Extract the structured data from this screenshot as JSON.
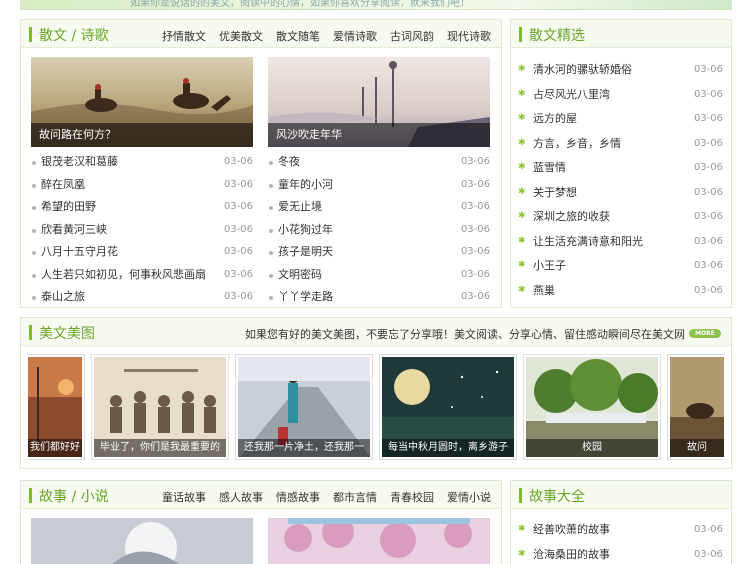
{
  "top_banner": {
    "text": "如果你是说话的的美文，阅读中的心情，如果你喜欢分享阅读，就来我们吧！"
  },
  "sanwen": {
    "title": "散文 / 诗歌",
    "links": [
      "抒情散文",
      "优美散文",
      "散文随笔",
      "爱情诗歌",
      "古词风韵",
      "现代诗歌"
    ],
    "featured": [
      {
        "caption": "故问路在何方？"
      },
      {
        "caption": "风沙吹走年华"
      }
    ],
    "left_list": [
      {
        "title": "银茂老汉和葛藤",
        "date": "03-06"
      },
      {
        "title": "醉在凤凰",
        "date": "03-06"
      },
      {
        "title": "希望的田野",
        "date": "03-06"
      },
      {
        "title": "欣看黄河三峡",
        "date": "03-06"
      },
      {
        "title": "八月十五守月花",
        "date": "03-06"
      },
      {
        "title": "人生若只如初见，何事秋风悲画扇",
        "date": "03-06"
      },
      {
        "title": "泰山之旅",
        "date": "03-06"
      }
    ],
    "right_list": [
      {
        "title": "冬夜",
        "date": "03-06"
      },
      {
        "title": "童年的小河",
        "date": "03-06"
      },
      {
        "title": "爱无止境",
        "date": "03-06"
      },
      {
        "title": "小花狗过年",
        "date": "03-06"
      },
      {
        "title": "孩子是明天",
        "date": "03-06"
      },
      {
        "title": "文明密码",
        "date": "03-06"
      },
      {
        "title": "丫丫学走路",
        "date": "03-06"
      }
    ]
  },
  "jingxuan": {
    "title": "散文精选",
    "items": [
      {
        "title": "清水河的骡驮轿婚俗",
        "date": "03-06"
      },
      {
        "title": "占尽风光八里湾",
        "date": "03-06"
      },
      {
        "title": "远方的屋",
        "date": "03-06"
      },
      {
        "title": "方言，乡音，乡情",
        "date": "03-06"
      },
      {
        "title": "蓝雪情",
        "date": "03-06"
      },
      {
        "title": "关于梦想",
        "date": "03-06"
      },
      {
        "title": "深圳之旅的收获",
        "date": "03-06"
      },
      {
        "title": "让生活充满诗意和阳光",
        "date": "03-06"
      },
      {
        "title": "小王子",
        "date": "03-06"
      },
      {
        "title": "燕巢",
        "date": "03-06"
      }
    ]
  },
  "meitu": {
    "title": "美文美图",
    "note": "如果您有好的美文美图，不要忘了分享哦！美文阅读、分享心情、留住感动瞬间尽在美文网",
    "more": "MORE",
    "items": [
      {
        "caption": "我们都好好"
      },
      {
        "caption": "毕业了，你们是我最重要的"
      },
      {
        "caption": "还我那一片净土，还我那一"
      },
      {
        "caption": "每当中秋月圆时，离乡游子"
      },
      {
        "caption": "校园"
      },
      {
        "caption": "故问"
      }
    ]
  },
  "gushi": {
    "title": "故事 / 小说",
    "links": [
      "童话故事",
      "感人故事",
      "情感故事",
      "都市言情",
      "青春校园",
      "爱情小说"
    ]
  },
  "gushidaquan": {
    "title": "故事大全",
    "items": [
      {
        "title": "经善吹萧的故事",
        "date": "03-06"
      },
      {
        "title": "沧海桑田的故事",
        "date": "03-06"
      }
    ]
  },
  "colors": {
    "accent": "#7cbd2a",
    "title": "#6aa52a",
    "header_bg": "#f7fbef",
    "border": "#dfe9cf"
  }
}
